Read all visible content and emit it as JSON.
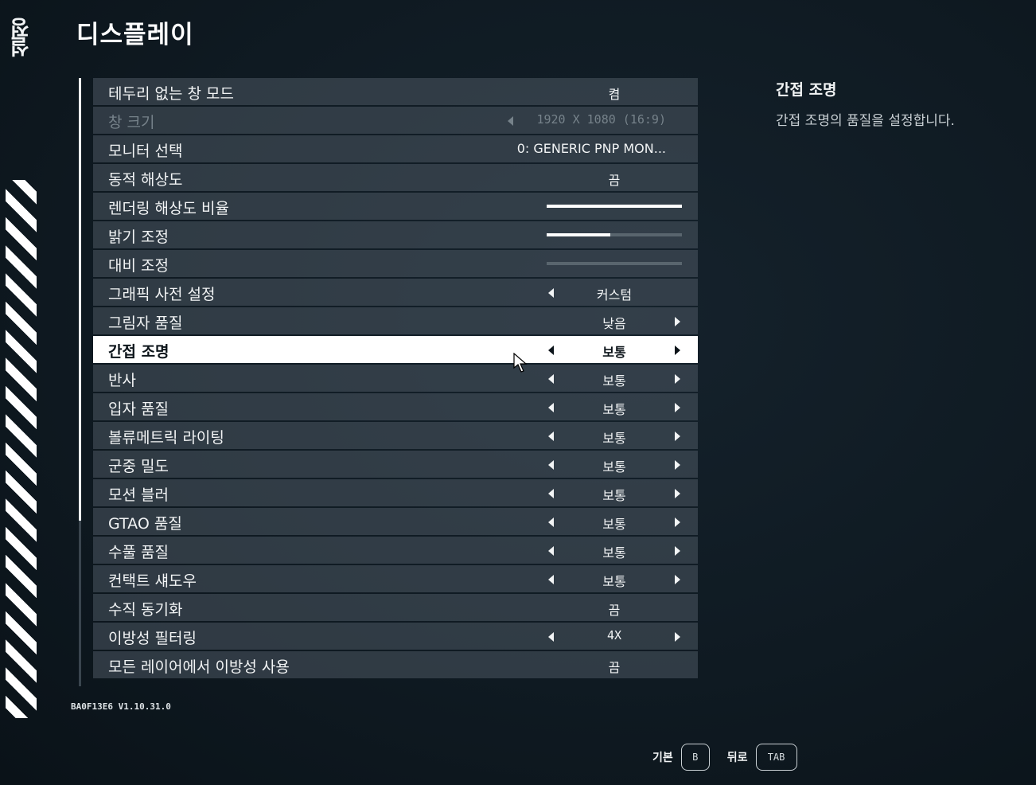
{
  "side_logo": "설정",
  "page_title": "디스플레이",
  "rows": [
    {
      "label": "테두리 없는 창 모드",
      "value": "켬"
    },
    {
      "label": "창 크기",
      "value": "1920 X 1080 (16:9)"
    },
    {
      "label": "모니터 선택",
      "value": "0: GENERIC PNP MON..."
    },
    {
      "label": "동적 해상도",
      "value": "끔"
    },
    {
      "label": "렌더링 해상도 비율",
      "value": "",
      "slider": 1.0
    },
    {
      "label": "밝기 조정",
      "value": "",
      "slider": 0.47
    },
    {
      "label": "대비 조정",
      "value": "",
      "slider": 0.0
    },
    {
      "label": "그래픽 사전 설정",
      "value": "커스텀"
    },
    {
      "label": "그림자 품질",
      "value": "낮음"
    },
    {
      "label": "간접 조명",
      "value": "보통"
    },
    {
      "label": "반사",
      "value": "보통"
    },
    {
      "label": "입자 품질",
      "value": "보통"
    },
    {
      "label": "볼류메트릭 라이팅",
      "value": "보통"
    },
    {
      "label": "군중 밀도",
      "value": "보통"
    },
    {
      "label": "모션 블러",
      "value": "보통"
    },
    {
      "label": "GTAO 품질",
      "value": "보통"
    },
    {
      "label": "수풀 품질",
      "value": "보통"
    },
    {
      "label": "컨택트 섀도우",
      "value": "보통"
    },
    {
      "label": "수직 동기화",
      "value": "끔"
    },
    {
      "label": "이방성 필터링",
      "value": "4X"
    },
    {
      "label": "모든 레이어에서 이방성 사용",
      "value": "끔"
    }
  ],
  "description": {
    "title": "간접 조명",
    "text": "간접 조명의 품질을 설정합니다."
  },
  "version": "BA0F13E6 V1.10.31.0",
  "footer": {
    "default_label": "기본",
    "default_key": "B",
    "back_label": "뒤로",
    "back_key": "TAB"
  }
}
